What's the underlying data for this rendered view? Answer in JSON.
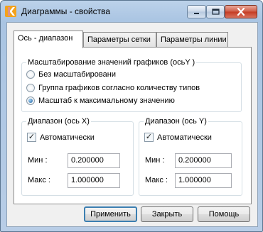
{
  "window": {
    "title": "Диаграммы - свойства",
    "icon": "app-k-icon"
  },
  "tabs": [
    {
      "label": "Ось - диапазон",
      "active": true
    },
    {
      "label": "Параметры сетки",
      "active": false
    },
    {
      "label": "Параметры линии",
      "active": false
    }
  ],
  "scaling": {
    "title": "Масштабирование значений графиков (осьY )",
    "options": [
      {
        "label": "Без масштабировани",
        "selected": false
      },
      {
        "label": "Группа графиков согласно количеству типов",
        "selected": false
      },
      {
        "label": "Масштаб к максимальному значению",
        "selected": true
      }
    ]
  },
  "range_x": {
    "title": "Диапазон (ось X)",
    "auto_label": "Автоматически",
    "auto_checked": true,
    "min_label": "Мин :",
    "min_value": "0.200000",
    "max_label": "Макс :",
    "max_value": "1.000000"
  },
  "range_y": {
    "title": "Диапазон (ось Y)",
    "auto_label": "Автоматически",
    "auto_checked": true,
    "min_label": "Мин :",
    "min_value": "0.200000",
    "max_label": "Макс :",
    "max_value": "1.000000"
  },
  "buttons": {
    "apply": "Применить",
    "close": "Закрыть",
    "help": "Помощь"
  }
}
